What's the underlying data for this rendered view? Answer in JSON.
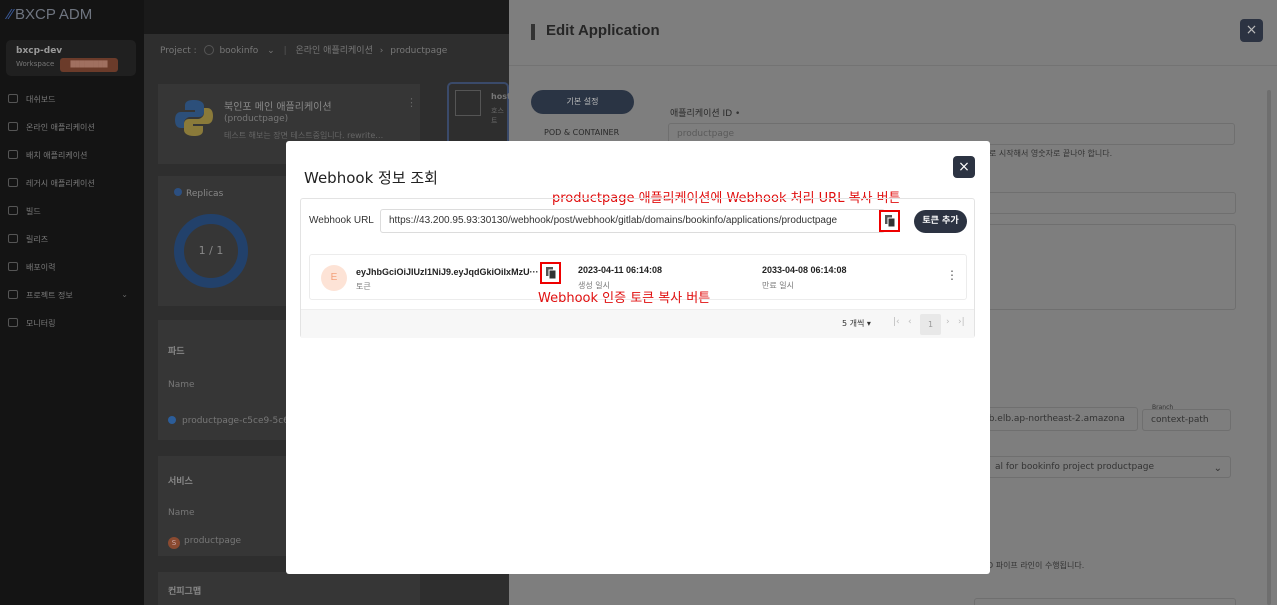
{
  "app": {
    "logo_text": "BXCP ADM",
    "add_symbol": "+"
  },
  "workspace": {
    "name": "bxcp-dev",
    "label": "Workspace",
    "badge": "████████"
  },
  "sidebar": {
    "items": [
      {
        "label": "대쉬보드"
      },
      {
        "label": "온라인 애플리케이션"
      },
      {
        "label": "배치 애플리케이션"
      },
      {
        "label": "레거시 애플리케이션"
      },
      {
        "label": "빌드"
      },
      {
        "label": "릴리즈"
      },
      {
        "label": "배포이력"
      },
      {
        "label": "프로젝트 정보"
      },
      {
        "label": "모니터링"
      }
    ]
  },
  "breadcrumb": {
    "project_label": "Project :",
    "project": "bookinfo",
    "section": "온라인 애플리케이션",
    "page": "productpage"
  },
  "app_card": {
    "title": "북인포 메인 애플리케이션",
    "subtitle": "(productpage)",
    "desc": "테스트 해보는 장면 테스트중입니다. rewrite…",
    "host_label": "host",
    "host_sub": "호스트"
  },
  "replicas": {
    "title": "Replicas",
    "value": "1 / 1"
  },
  "pods": {
    "heading": "파드",
    "col_name": "Name",
    "row": "productpage-c5ce9-5c6"
  },
  "services": {
    "heading": "서비스",
    "col_name": "Name",
    "row": "productpage",
    "badge": "S"
  },
  "configmap": {
    "heading": "컨피그맵"
  },
  "drawer": {
    "title": "Edit Application",
    "close": "×",
    "tab_basic": "기본 설정",
    "tab_pod": "POD & CONTAINER",
    "app_id_label": "애플리케이션 ID",
    "app_id_required": "•",
    "app_id_placeholder": "productpage",
    "app_id_hint": "로 시작해서 영숫자로 끝나야 합니다.",
    "url_fragment": "bb.elb.ap-northeast-2.amazona",
    "branch_label": "Branch",
    "branch_value": "context-path",
    "pipeline_value": "al for bookinfo project productpage",
    "pipeline_hint": "D 파이프 라인이 수행됩니다."
  },
  "modal": {
    "title": "Webhook 정보 조회",
    "close": "×",
    "url_label": "Webhook URL",
    "url_value": "https://43.200.95.93:30130/webhook/post/webhook/gitlab/domains/bookinfo/applications/productpage",
    "add_token": "토큰 추가",
    "token": {
      "avatar": "E",
      "value": "eyJhbGciOiJIUzI1NiJ9.eyJqdGkiOiIxMzU···",
      "type": "토큰",
      "created": "2023-04-11 06:14:08",
      "created_label": "생성 일시",
      "expires": "2033-04-08 06:14:08",
      "expires_label": "만료 일시"
    },
    "page_size": "5 개씩",
    "page_current": "1",
    "note_url": "productpage 애플리케이션에  Webhook 처리 URL 복사 버튼",
    "note_token": "Webhook 인증 토큰 복사 버튼"
  },
  "colors": {
    "note_red": "#e01010",
    "dark_btn": "#2c3342",
    "avatar_bg": "#fde3d6"
  }
}
